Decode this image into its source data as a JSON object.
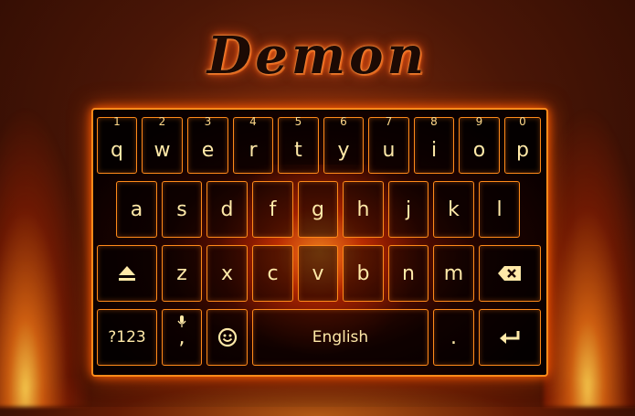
{
  "title": "Demon",
  "rows": {
    "row1": [
      {
        "label": "q",
        "hint": "1"
      },
      {
        "label": "w",
        "hint": "2"
      },
      {
        "label": "e",
        "hint": "3"
      },
      {
        "label": "r",
        "hint": "4"
      },
      {
        "label": "t",
        "hint": "5"
      },
      {
        "label": "y",
        "hint": "6"
      },
      {
        "label": "u",
        "hint": "7"
      },
      {
        "label": "i",
        "hint": "8"
      },
      {
        "label": "o",
        "hint": "9"
      },
      {
        "label": "p",
        "hint": "0"
      }
    ],
    "row2": [
      "a",
      "s",
      "d",
      "f",
      "g",
      "h",
      "j",
      "k",
      "l"
    ],
    "row3": [
      "z",
      "x",
      "c",
      "v",
      "b",
      "n",
      "m"
    ]
  },
  "bottom": {
    "symbols_label": "?123",
    "comma_label": ",",
    "space_label": "English",
    "period_label": "."
  },
  "icons": {
    "shift": "shift-icon",
    "backspace": "backspace-icon",
    "mic": "mic-icon",
    "emoji": "emoji-icon",
    "enter": "enter-icon"
  },
  "colors": {
    "key_border": "#ff8a1a",
    "key_text": "#ffe9a8",
    "title": "#1c0a04"
  }
}
